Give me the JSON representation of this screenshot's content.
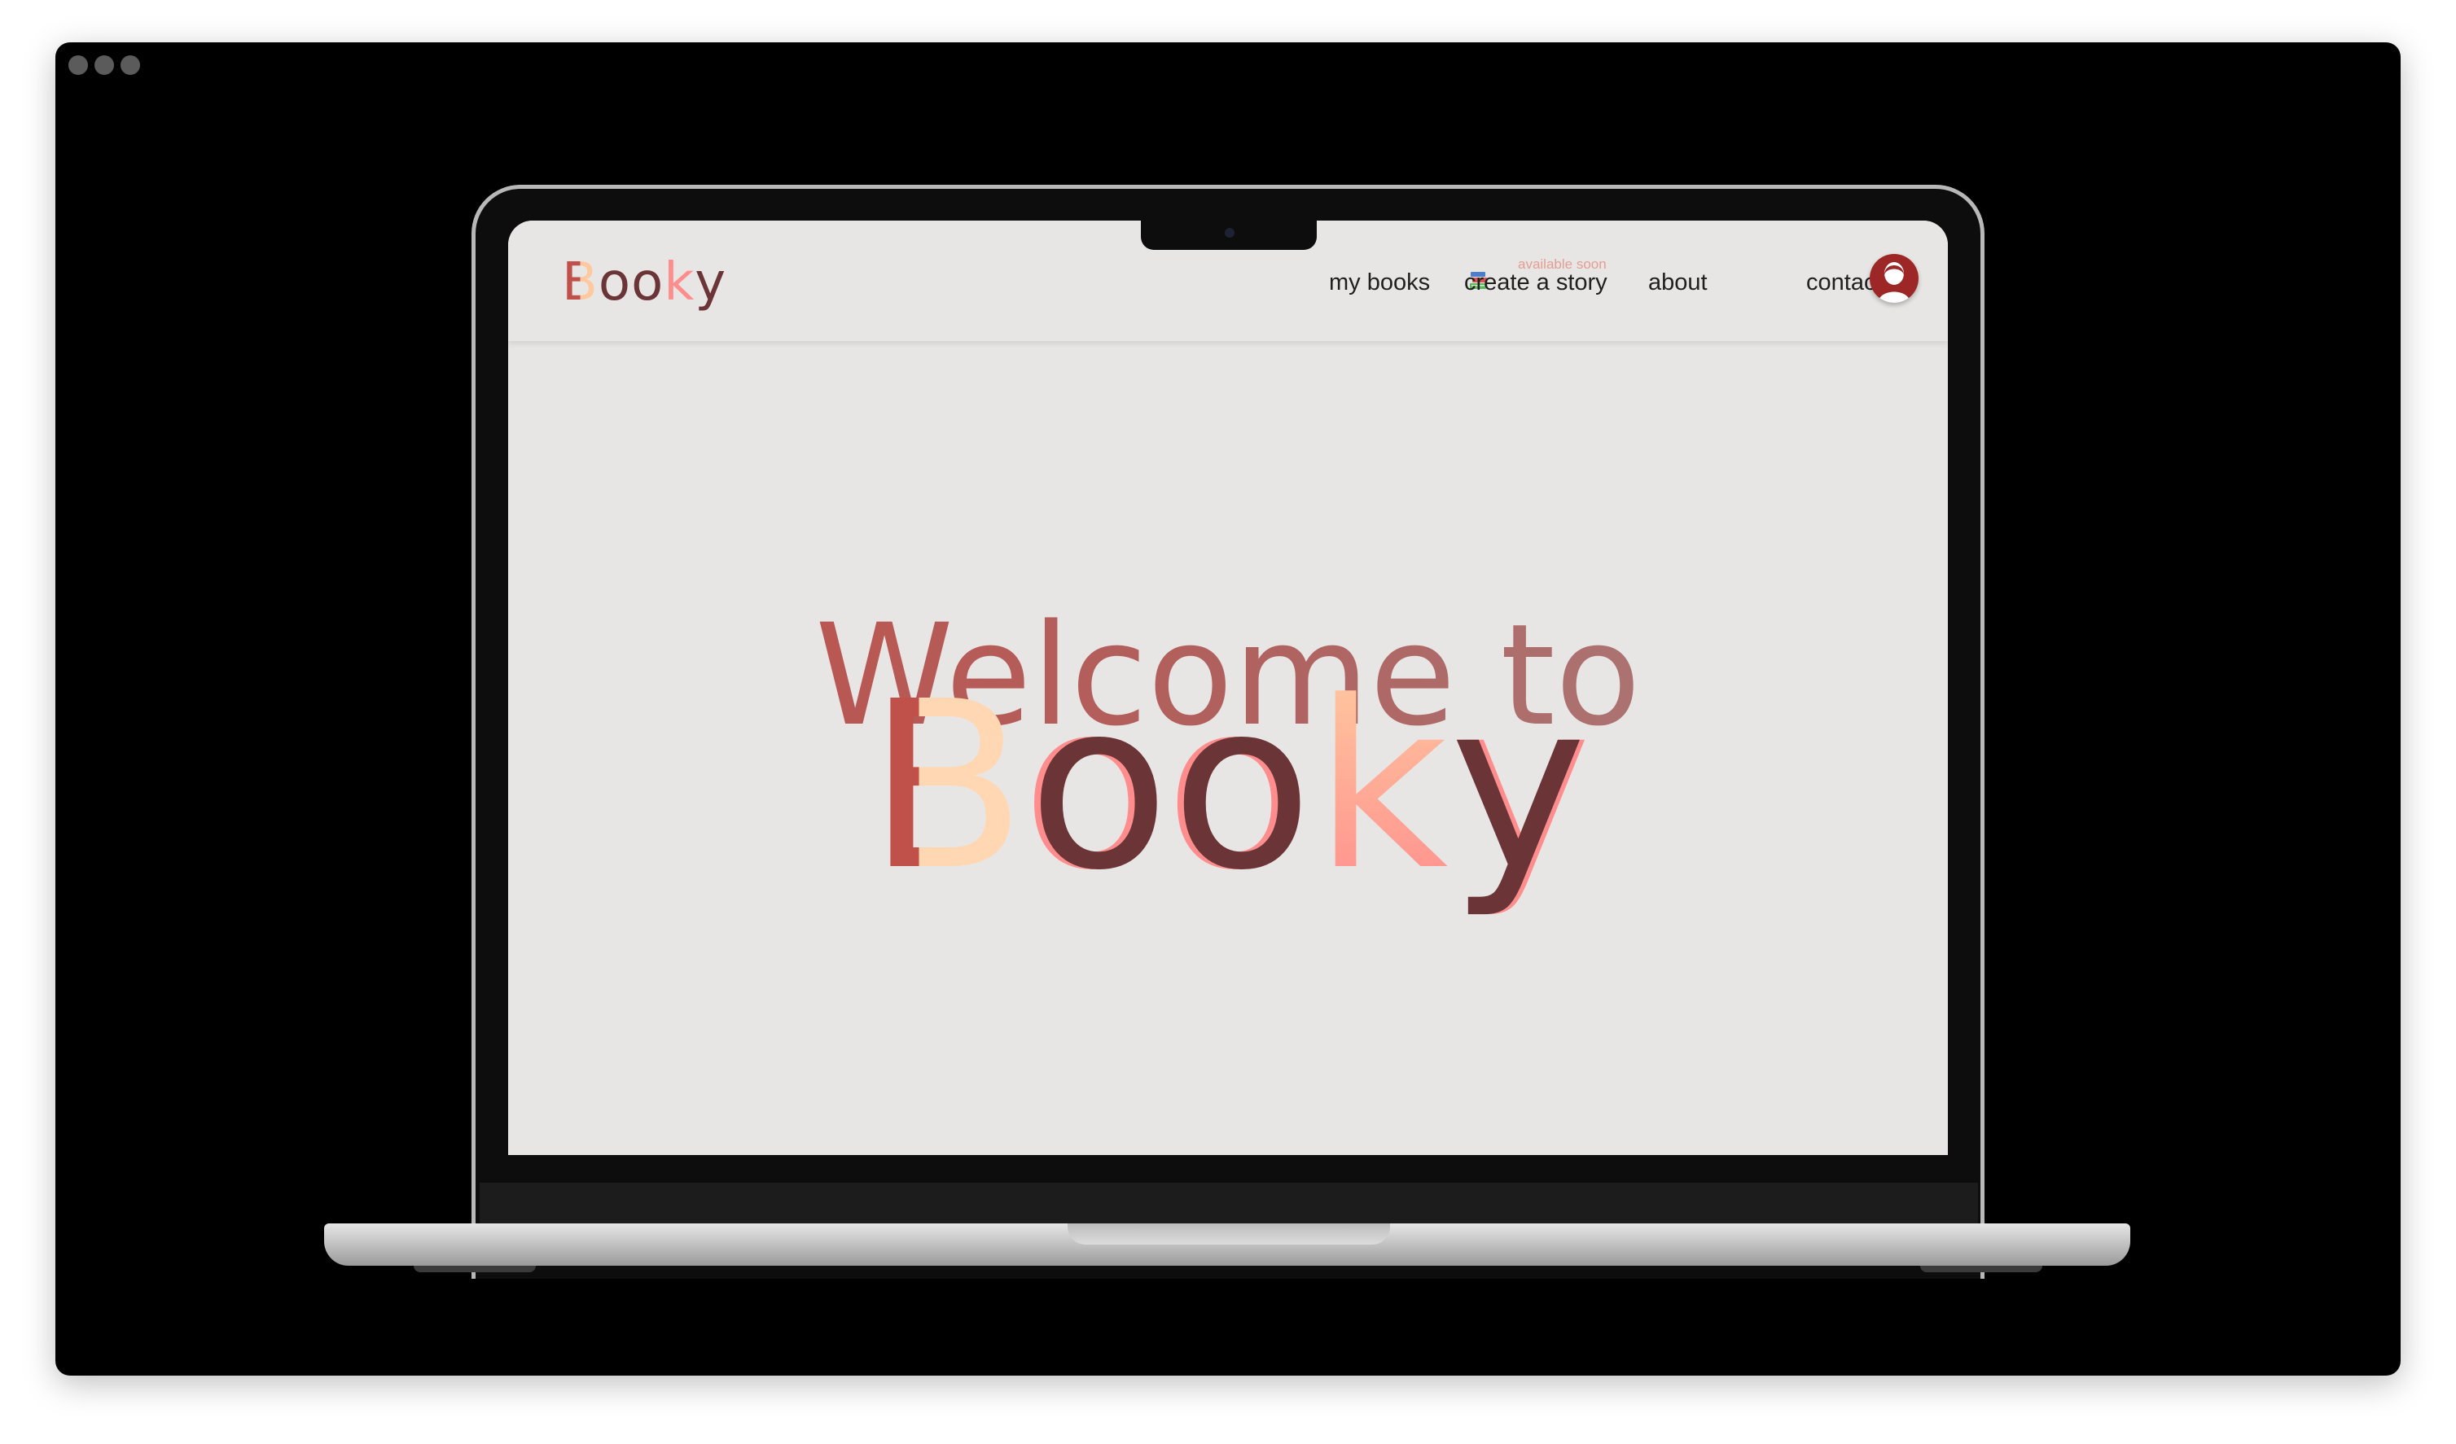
{
  "window": {
    "controls": [
      "close",
      "minimize",
      "maximize"
    ]
  },
  "site": {
    "logo_letters": [
      "B",
      "o",
      "o",
      "k",
      "y"
    ],
    "nav": {
      "my_books": "my books",
      "my_books_icon": "books-emoji",
      "create_story": "create a story",
      "create_story_badge": "available soon",
      "about": "about",
      "contact": "contact"
    },
    "avatar_icon": "user-avatar-icon",
    "hero": {
      "line1": "Welcome to",
      "line2_letters": [
        "B",
        "o",
        "o",
        "k",
        "y"
      ]
    }
  },
  "colors": {
    "page_background": "#e8e6e5",
    "brand_red": "#c0504a",
    "brand_dark": "#6b3436",
    "brand_peach": "#ffc9a0",
    "brand_pink": "#ff8d8d",
    "avatar_red": "#9d2726"
  }
}
